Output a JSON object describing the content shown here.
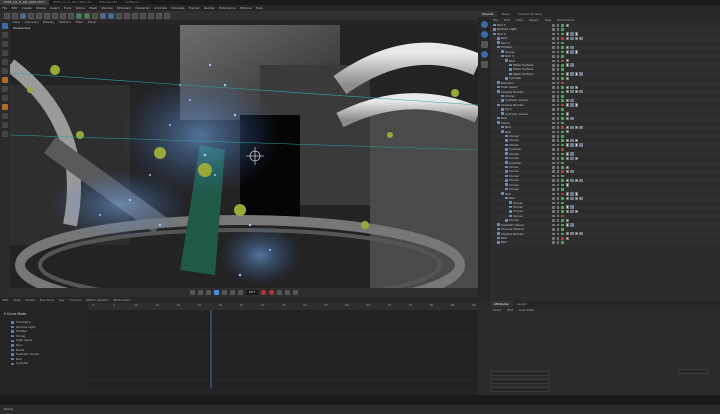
{
  "window": {
    "tabs": [
      "Sh01_CA_cl_AD_v102.c4d *",
      "Sh01_CA_cl_AD_v102.c4d",
      "Startup.c4d",
      "Untitled 1"
    ],
    "active_tab_index": 0
  },
  "menubar": [
    "File",
    "Edit",
    "Create",
    "Modes",
    "Select",
    "Tools",
    "Spline",
    "Mesh",
    "Volume",
    "MoGraph",
    "Character",
    "Animate",
    "Simulate",
    "Tracker",
    "Render",
    "Extensions",
    "Window",
    "Help"
  ],
  "viewport": {
    "menu": [
      "View",
      "Cameras",
      "Display",
      "Options",
      "Filter",
      "Panel"
    ],
    "label": "Perspective",
    "background": "#1c1c1c"
  },
  "timeline": {
    "current_frame": "28 F",
    "menu": [
      "Edit",
      "View",
      "Frame",
      "Functions",
      "Key",
      "F-Curve",
      "Motion System",
      "Bookmarks"
    ],
    "ruler_ticks": [
      "0",
      "5",
      "10",
      "15",
      "20",
      "25",
      "30",
      "35",
      "40",
      "45",
      "50",
      "55",
      "60",
      "65",
      "70",
      "75",
      "80",
      "85",
      "90"
    ],
    "tracks": [
      "Summary",
      "Particle Light",
      "Emitter",
      "Cloner",
      "Push Apart",
      "Pyro",
      "Fields",
      "Cylinder Cloner",
      "Null",
      "Cylinder"
    ],
    "mode_label": "F-Curve Mode"
  },
  "status": {
    "text": "Ready"
  },
  "object_manager": {
    "tabs": [
      "Objects",
      "Takes",
      "Content Browser"
    ],
    "active_tab_index": 0,
    "menu": [
      "File",
      "Edit",
      "View",
      "Object",
      "Tags",
      "Bookmarks"
    ],
    "objects": [
      {
        "name": "Null 1",
        "indent": 0
      },
      {
        "name": "Particle Light",
        "indent": 0
      },
      {
        "name": "Null 2",
        "indent": 0
      },
      {
        "name": "Null",
        "indent": 1
      },
      {
        "name": "Null 3",
        "indent": 1
      },
      {
        "name": "Emitter",
        "indent": 1
      },
      {
        "name": "Cloner",
        "indent": 2
      },
      {
        "name": "Null 4",
        "indent": 2
      },
      {
        "name": "Null",
        "indent": 3
      },
      {
        "name": "Mesh Surface",
        "indent": 4
      },
      {
        "name": "Mesh Surface",
        "indent": 4
      },
      {
        "name": "Mesh Surface",
        "indent": 4
      },
      {
        "name": "Cylinder",
        "indent": 3
      },
      {
        "name": "Random",
        "indent": 1
      },
      {
        "name": "Push Apart",
        "indent": 1
      },
      {
        "name": "Volume Builder",
        "indent": 1
      },
      {
        "name": "Cloner",
        "indent": 2
      },
      {
        "name": "Cylinder Cloner",
        "indent": 2
      },
      {
        "name": "Volume Builder",
        "indent": 1
      },
      {
        "name": "Pyro",
        "indent": 2
      },
      {
        "name": "Cylinder Cloner",
        "indent": 2
      },
      {
        "name": "Null",
        "indent": 1
      },
      {
        "name": "Fields",
        "indent": 1
      },
      {
        "name": "Null",
        "indent": 2
      },
      {
        "name": "Null",
        "indent": 2
      },
      {
        "name": "Cloner",
        "indent": 3
      },
      {
        "name": "Cloner",
        "indent": 3
      },
      {
        "name": "Cloner",
        "indent": 3
      },
      {
        "name": "Cylinder",
        "indent": 3
      },
      {
        "name": "Cloner",
        "indent": 3
      },
      {
        "name": "Cloner",
        "indent": 3
      },
      {
        "name": "Cylinder",
        "indent": 3
      },
      {
        "name": "Cloner",
        "indent": 3
      },
      {
        "name": "Cloner",
        "indent": 3
      },
      {
        "name": "Cloner",
        "indent": 3
      },
      {
        "name": "Cloner",
        "indent": 3
      },
      {
        "name": "Cloner",
        "indent": 3
      },
      {
        "name": "Cloner",
        "indent": 3
      },
      {
        "name": "Null",
        "indent": 2
      },
      {
        "name": "Null",
        "indent": 3
      },
      {
        "name": "Cloner",
        "indent": 4
      },
      {
        "name": "Cloner",
        "indent": 4
      },
      {
        "name": "Cloner",
        "indent": 4
      },
      {
        "name": "Cloner",
        "indent": 4
      },
      {
        "name": "Cloner",
        "indent": 3
      },
      {
        "name": "Cylinder Cloner",
        "indent": 1
      },
      {
        "name": "Volume Mesher",
        "indent": 1
      },
      {
        "name": "Volume Builder",
        "indent": 1
      },
      {
        "name": "Null",
        "indent": 1
      },
      {
        "name": "Null",
        "indent": 1
      }
    ]
  },
  "attributes": {
    "tabs": [
      "Attributes",
      "Layers"
    ],
    "active_tab_index": 0,
    "menu": [
      "Mode",
      "Edit",
      "User Data"
    ]
  }
}
